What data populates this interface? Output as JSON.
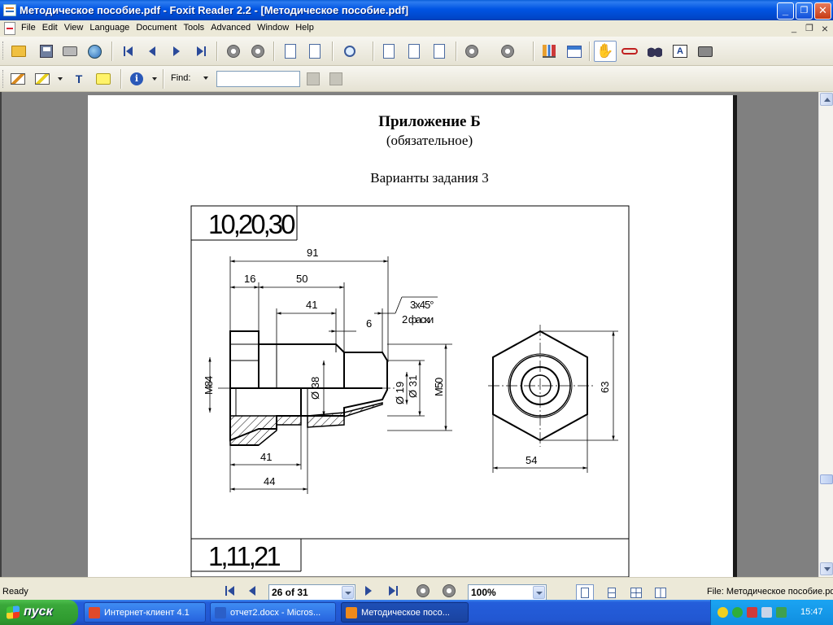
{
  "window": {
    "title": "Методическое пособие.pdf - Foxit Reader 2.2 - [Методическое пособие.pdf]",
    "minimize_label": "_",
    "maximize_label": "❐",
    "close_label": "✕"
  },
  "menu": {
    "items": [
      "File",
      "Edit",
      "View",
      "Language",
      "Document",
      "Tools",
      "Advanced",
      "Window",
      "Help"
    ],
    "mdi_minimize": "_",
    "mdi_restore": "❐",
    "mdi_close": "×"
  },
  "toolbar2": {
    "find_label": "Find:",
    "find_value": "",
    "typewriter_glyph": "T"
  },
  "document": {
    "heading": "Приложение Б",
    "subheading": "(обязательное)",
    "caption": "Варианты задания 3",
    "variant_1": "10,20,30",
    "variant_2": "1,11,21",
    "dims": {
      "d91": "91",
      "d16": "16",
      "d50": "50",
      "d41_top": "41",
      "chamfer_1": "3х45°",
      "chamfer_2": "2 фаски",
      "d6": "6",
      "m84": "М84",
      "o38": "Ø 38",
      "o19": "Ø 19",
      "o31": "Ø 31",
      "m50": "М50",
      "d41_bottom": "41",
      "d44": "44",
      "d63": "63",
      "d54": "54"
    }
  },
  "status": {
    "ready": "Ready",
    "page_field": "26 of 31",
    "zoom_field": "100%",
    "file_info": "File: Методическое пособие.pdf"
  },
  "taskbar": {
    "start_label": "пуск",
    "tasks": [
      {
        "label": "Интернет-клиент 4.1",
        "color": "#e04a2a"
      },
      {
        "label": "отчет2.docx - Micros...",
        "color": "#2b5fc8"
      },
      {
        "label": "Методическое посо...",
        "color": "#f08a1a"
      }
    ],
    "clock": "15:47"
  }
}
